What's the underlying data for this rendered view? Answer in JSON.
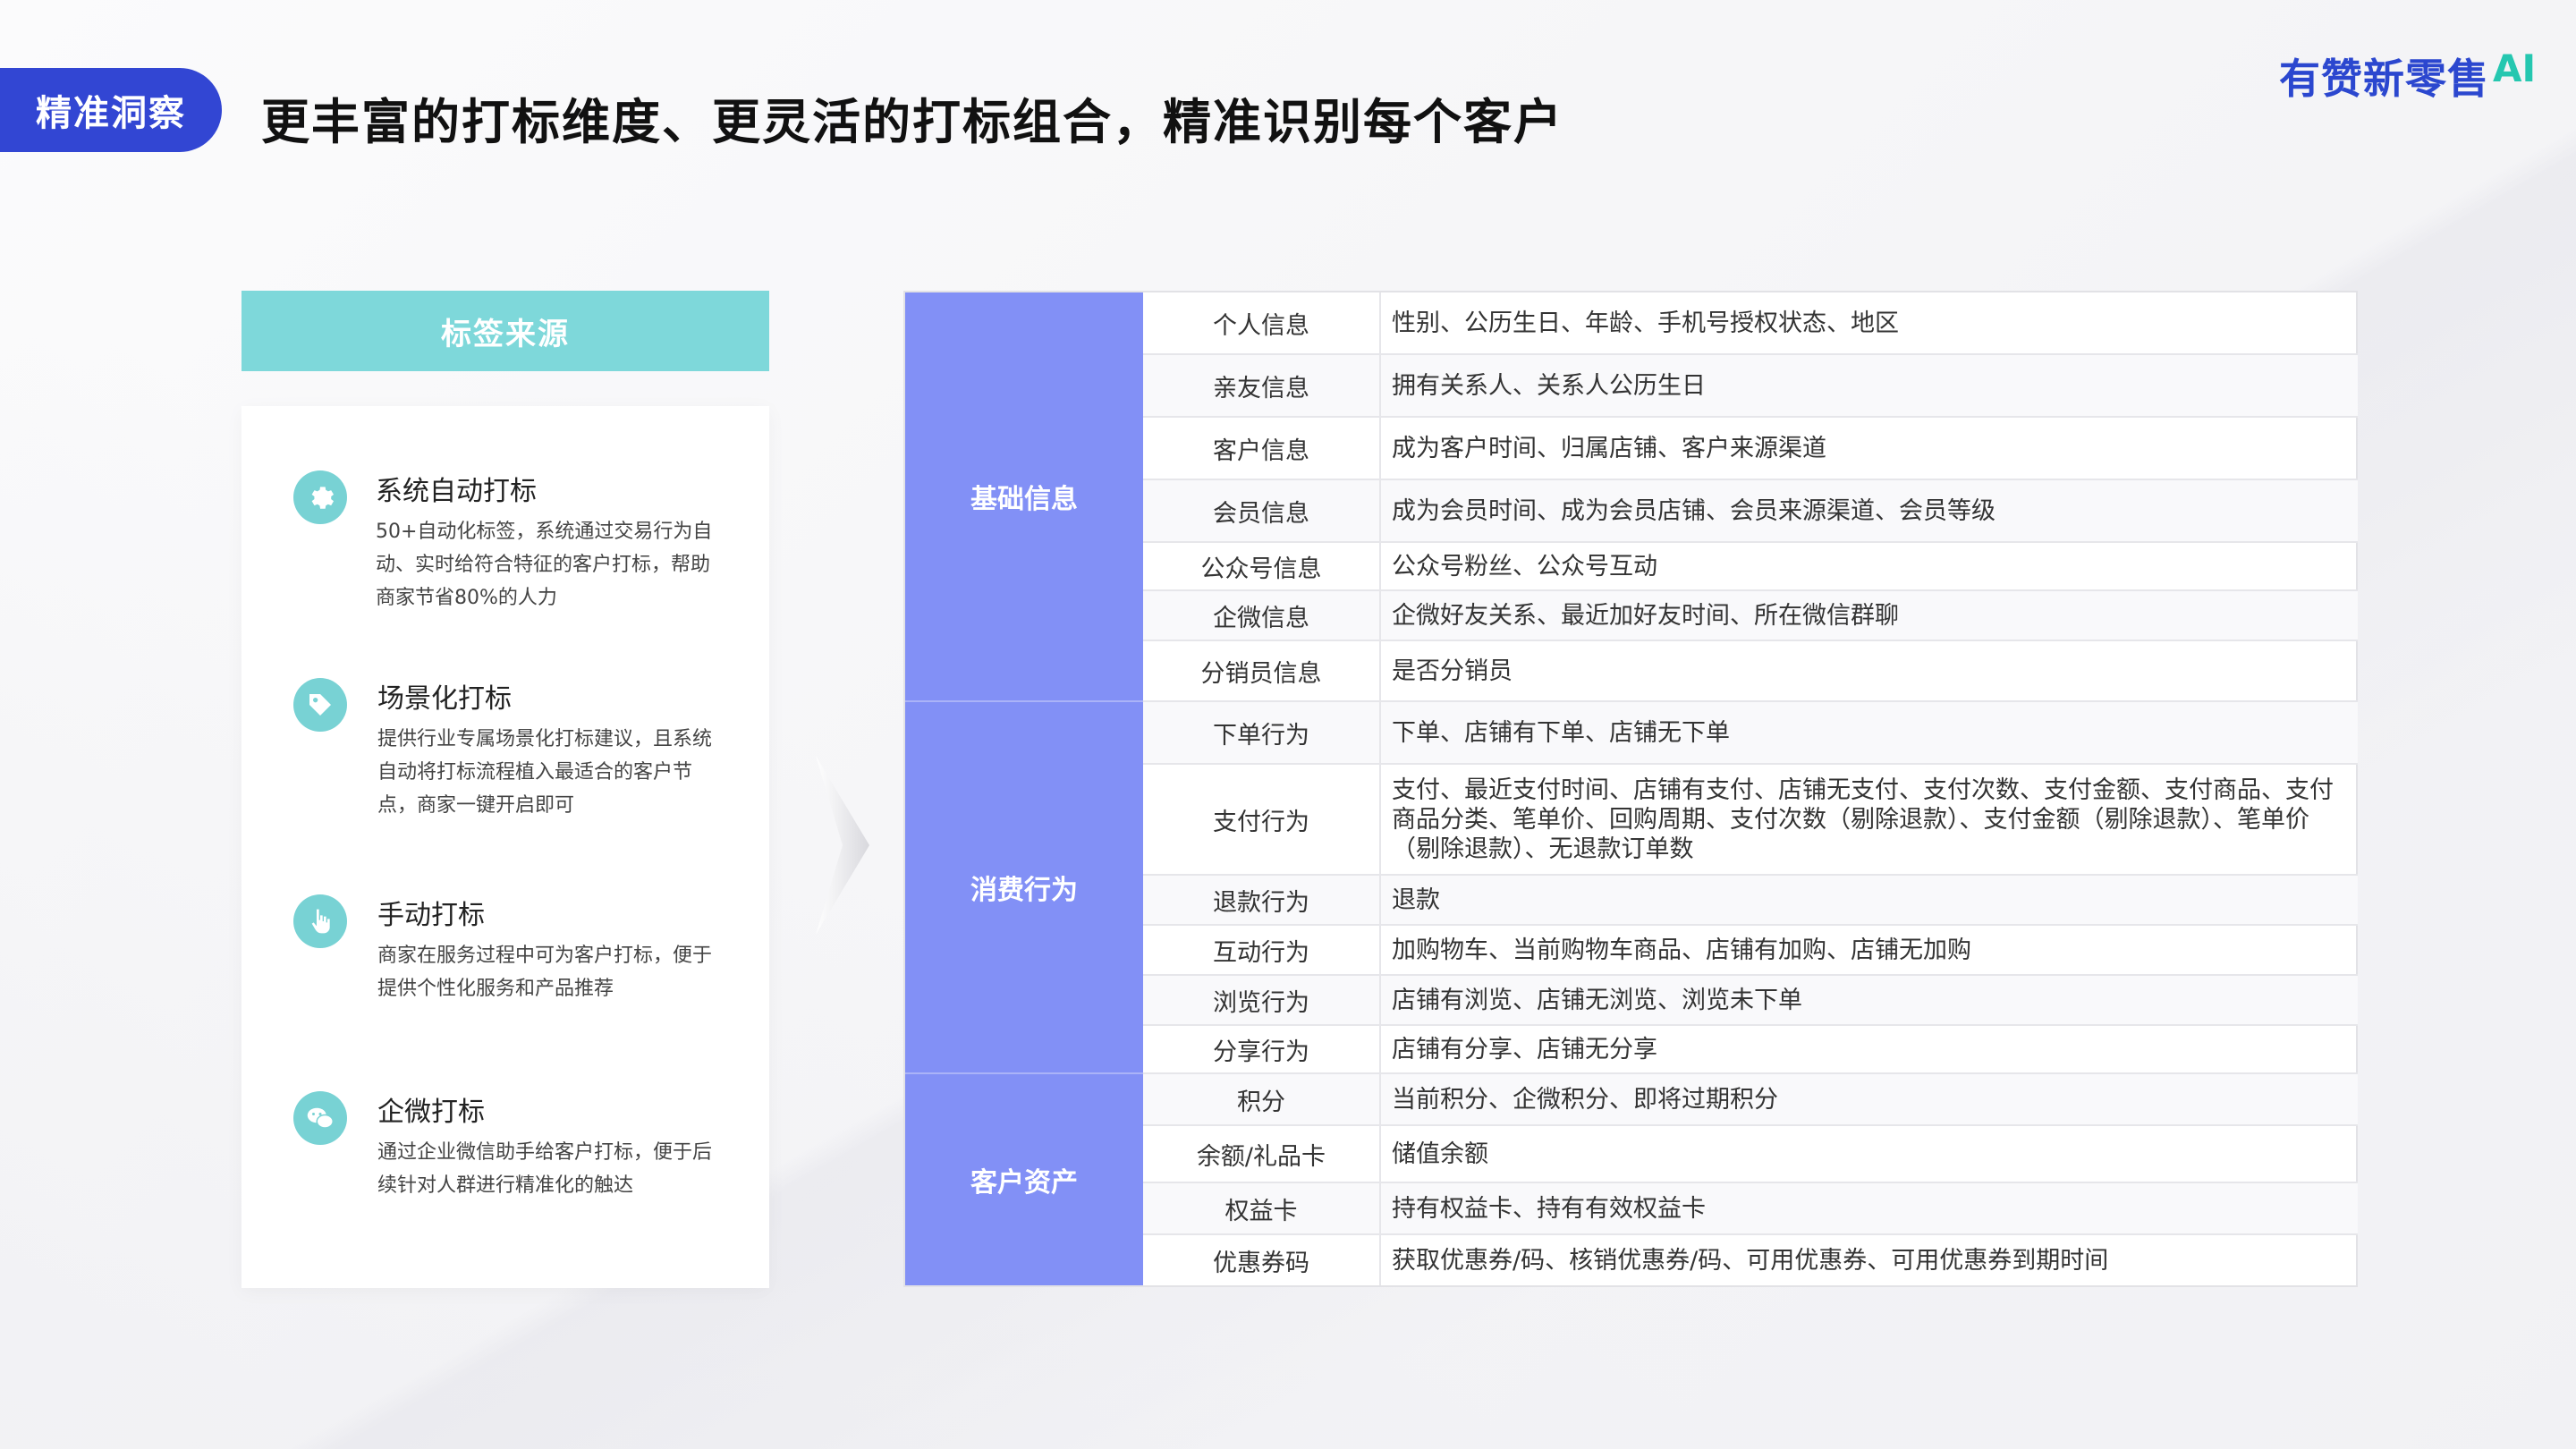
{
  "header": {
    "section_label": "精准洞察",
    "title": "更丰富的打标维度、更灵活的打标组合，精准识别每个客户",
    "brand_text": "有赞新零售",
    "brand_ai": "AI"
  },
  "colors": {
    "accent_blue": "#3246d3",
    "teal": "#7ed8da",
    "category_purple": "#8290f6",
    "brand_teal": "#25c7b0"
  },
  "sources": {
    "header": "标签来源",
    "items": [
      {
        "icon": "gear-icon",
        "title": "系统自动打标",
        "desc": "50+自动化标签，系统通过交易行为自动、实时给符合特征的客户打标，帮助商家节省80%的人力"
      },
      {
        "icon": "tag-icon",
        "title": "场景化打标",
        "desc": "提供行业专属场景化打标建议，且系统自动将打标流程植入最适合的客户节点，商家一键开启即可"
      },
      {
        "icon": "hand-pointer-icon",
        "title": "手动打标",
        "desc": "商家在服务过程中可为客户打标，便于提供个性化服务和产品推荐"
      },
      {
        "icon": "wechat-icon",
        "title": "企微打标",
        "desc": "通过企业微信助手给客户打标，便于后续针对人群进行精准化的触达"
      }
    ]
  },
  "table": {
    "categories": [
      "基础信息",
      "消费行为",
      "客户资产"
    ],
    "rows": [
      {
        "sub": "个人信息",
        "val": "性别、公历生日、年龄、手机号授权状态、地区"
      },
      {
        "sub": "亲友信息",
        "val": "拥有关系人、关系人公历生日"
      },
      {
        "sub": "客户信息",
        "val": "成为客户时间、归属店铺、客户来源渠道"
      },
      {
        "sub": "会员信息",
        "val": "成为会员时间、成为会员店铺、会员来源渠道、会员等级"
      },
      {
        "sub": "公众号信息",
        "val": "公众号粉丝、公众号互动"
      },
      {
        "sub": "企微信息",
        "val": "企微好友关系、最近加好友时间、所在微信群聊"
      },
      {
        "sub": "分销员信息",
        "val": "是否分销员"
      },
      {
        "sub": "下单行为",
        "val": "下单、店铺有下单、店铺无下单"
      },
      {
        "sub": "支付行为",
        "val": "支付、最近支付时间、店铺有支付、店铺无支付、支付次数、支付金额、支付商品、支付商品分类、笔单价、回购周期、支付次数（剔除退款）、支付金额（剔除退款）、笔单价（剔除退款）、无退款订单数"
      },
      {
        "sub": "退款行为",
        "val": "退款"
      },
      {
        "sub": "互动行为",
        "val": "加购物车、当前购物车商品、店铺有加购、店铺无加购"
      },
      {
        "sub": "浏览行为",
        "val": "店铺有浏览、店铺无浏览、浏览未下单"
      },
      {
        "sub": "分享行为",
        "val": "店铺有分享、店铺无分享"
      },
      {
        "sub": "积分",
        "val": "当前积分、企微积分、即将过期积分"
      },
      {
        "sub": "余额/礼品卡",
        "val": "储值余额"
      },
      {
        "sub": "权益卡",
        "val": "持有权益卡、持有有效权益卡"
      },
      {
        "sub": "优惠券码",
        "val": "获取优惠券/码、核销优惠券/码、可用优惠券、可用优惠券到期时间"
      }
    ]
  }
}
